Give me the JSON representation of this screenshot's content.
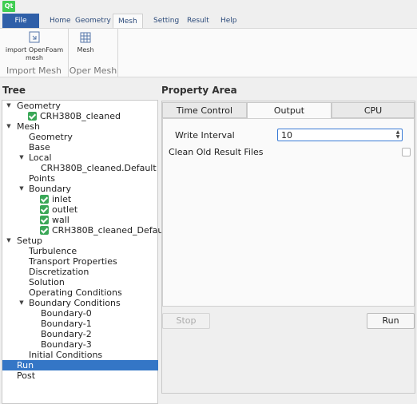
{
  "app": {
    "logo_text": "Qt"
  },
  "menu": {
    "tabs": [
      {
        "label": "File"
      },
      {
        "label": "Home"
      },
      {
        "label": "Geometry"
      },
      {
        "label": "Mesh"
      },
      {
        "label": "Setting"
      },
      {
        "label": "Result"
      },
      {
        "label": "Help"
      }
    ],
    "active": "Mesh"
  },
  "ribbon": {
    "groups": [
      {
        "title": "Import Mesh",
        "buttons": [
          {
            "label_line1": "import OpenFoam",
            "label_line2": "mesh",
            "icon": "import-mesh-icon"
          }
        ]
      },
      {
        "title": "Oper Mesh",
        "buttons": [
          {
            "label_line1": "Mesh",
            "icon": "mesh-grid-icon"
          }
        ]
      }
    ]
  },
  "tree": {
    "title": "Tree",
    "rows": [
      {
        "label": "Geometry",
        "expanded": true
      },
      {
        "label": "CRH380B_cleaned",
        "checked": true
      },
      {
        "label": "Mesh",
        "expanded": true
      },
      {
        "label": "Geometry"
      },
      {
        "label": "Base"
      },
      {
        "label": "Local",
        "expanded": true
      },
      {
        "label": "CRH380B_cleaned.Default"
      },
      {
        "label": "Points"
      },
      {
        "label": "Boundary",
        "expanded": true
      },
      {
        "label": "inlet",
        "checked": true
      },
      {
        "label": "outlet",
        "checked": true
      },
      {
        "label": "wall",
        "checked": true
      },
      {
        "label": "CRH380B_cleaned_Defau",
        "checked": true
      },
      {
        "label": "Setup",
        "expanded": true
      },
      {
        "label": "Turbulence"
      },
      {
        "label": "Transport Properties"
      },
      {
        "label": "Discretization"
      },
      {
        "label": "Solution"
      },
      {
        "label": "Operating Conditions"
      },
      {
        "label": "Boundary Conditions",
        "expanded": true
      },
      {
        "label": "Boundary-0"
      },
      {
        "label": "Boundary-1"
      },
      {
        "label": "Boundary-2"
      },
      {
        "label": "Boundary-3"
      },
      {
        "label": "Initial Conditions"
      },
      {
        "label": "Run",
        "selected": true
      },
      {
        "label": "Post"
      }
    ]
  },
  "property": {
    "title": "Property Area",
    "tabs": [
      {
        "label": "Time Control"
      },
      {
        "label": "Output"
      },
      {
        "label": "CPU"
      }
    ],
    "active_tab": "Output",
    "write_interval_label": "Write Interval",
    "write_interval_value": "10",
    "clean_label": "Clean Old Result Files",
    "clean_checked": false,
    "stop_label": "Stop",
    "run_label": "Run"
  },
  "colors": {
    "accent": "#3476c6",
    "file_tab": "#2f5fa8",
    "check_green": "#3aa757"
  }
}
